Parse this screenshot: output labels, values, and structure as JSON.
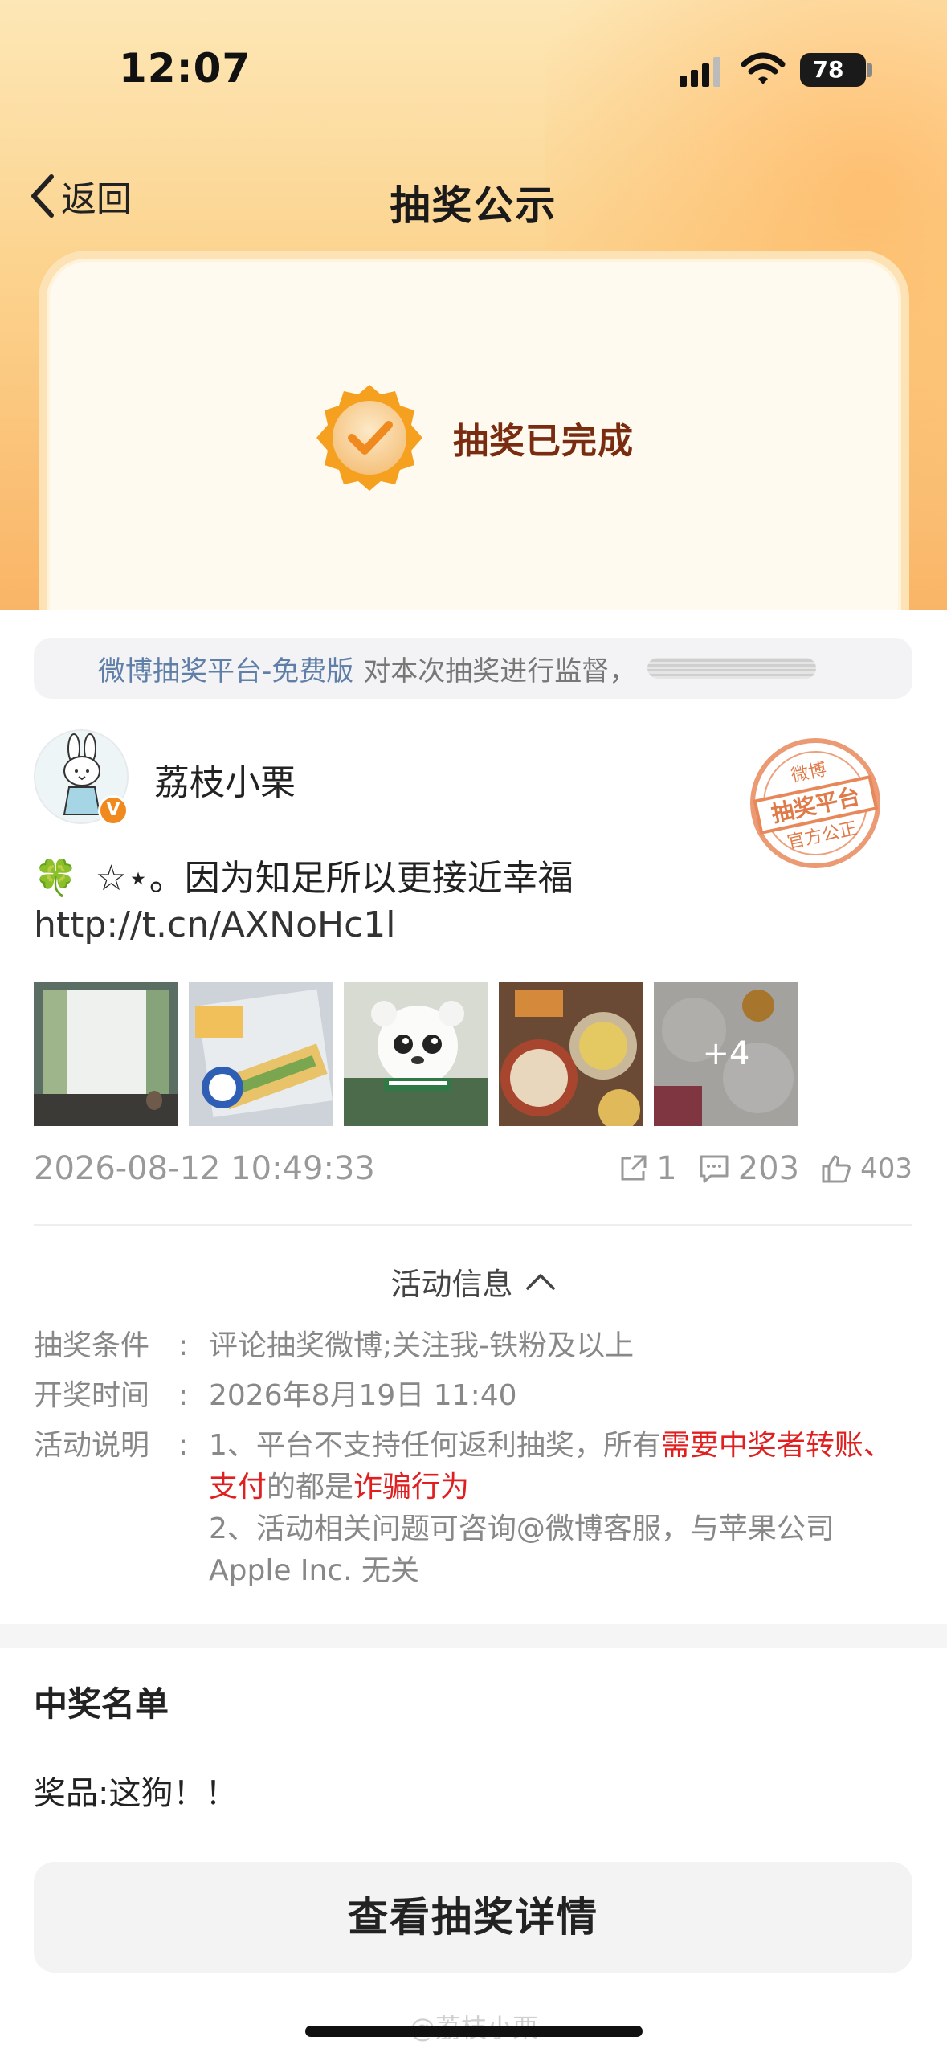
{
  "status_bar": {
    "time": "12:07",
    "battery": "78"
  },
  "nav": {
    "back_label": "返回",
    "title": "抽奖公示"
  },
  "hero": {
    "status_text": "抽奖已完成"
  },
  "notice": {
    "link_text": "微博抽奖平台-免费版",
    "text": "对本次抽奖进行监督，"
  },
  "author": {
    "name": "荔枝小栗",
    "verified_badge": "V"
  },
  "stamp": {
    "line1": "微博",
    "line2": "抽奖平台",
    "line3": "官方公正"
  },
  "post": {
    "clover_icon": "🍀",
    "text": "☆⋆。因为知足所以更接近幸福",
    "link": "http://t.cn/AXNoHc1l",
    "more_images": "+4",
    "time": "2026-08-12 10:49:33",
    "reposts": "1",
    "comments": "203",
    "likes": "403"
  },
  "activity": {
    "toggle_label": "活动信息",
    "rows": [
      {
        "key": "抽奖条件",
        "value": "评论抽奖微博;关注我-铁粉及以上"
      },
      {
        "key": "开奖时间",
        "value": "2026年8月19日 11:40"
      }
    ],
    "desc_key": "活动说明",
    "desc_1a": "1、平台不支持任何返利抽奖，所有",
    "desc_1b": "需要中奖者转账、支付",
    "desc_1c": "的都是",
    "desc_1d": "诈骗行为",
    "desc_2": "2、活动相关问题可咨询@微博客服，与苹果公司 Apple Inc. 无关"
  },
  "winners": {
    "title": "中奖名单",
    "prize_line": "奖品:这狗！！"
  },
  "detail_button": "查看抽奖详情",
  "watermark": "@荔枝小栗",
  "colors": {
    "accent_orange": "#f08a1e",
    "warning_red": "#e02020",
    "link_blue": "#5f7fa8"
  }
}
